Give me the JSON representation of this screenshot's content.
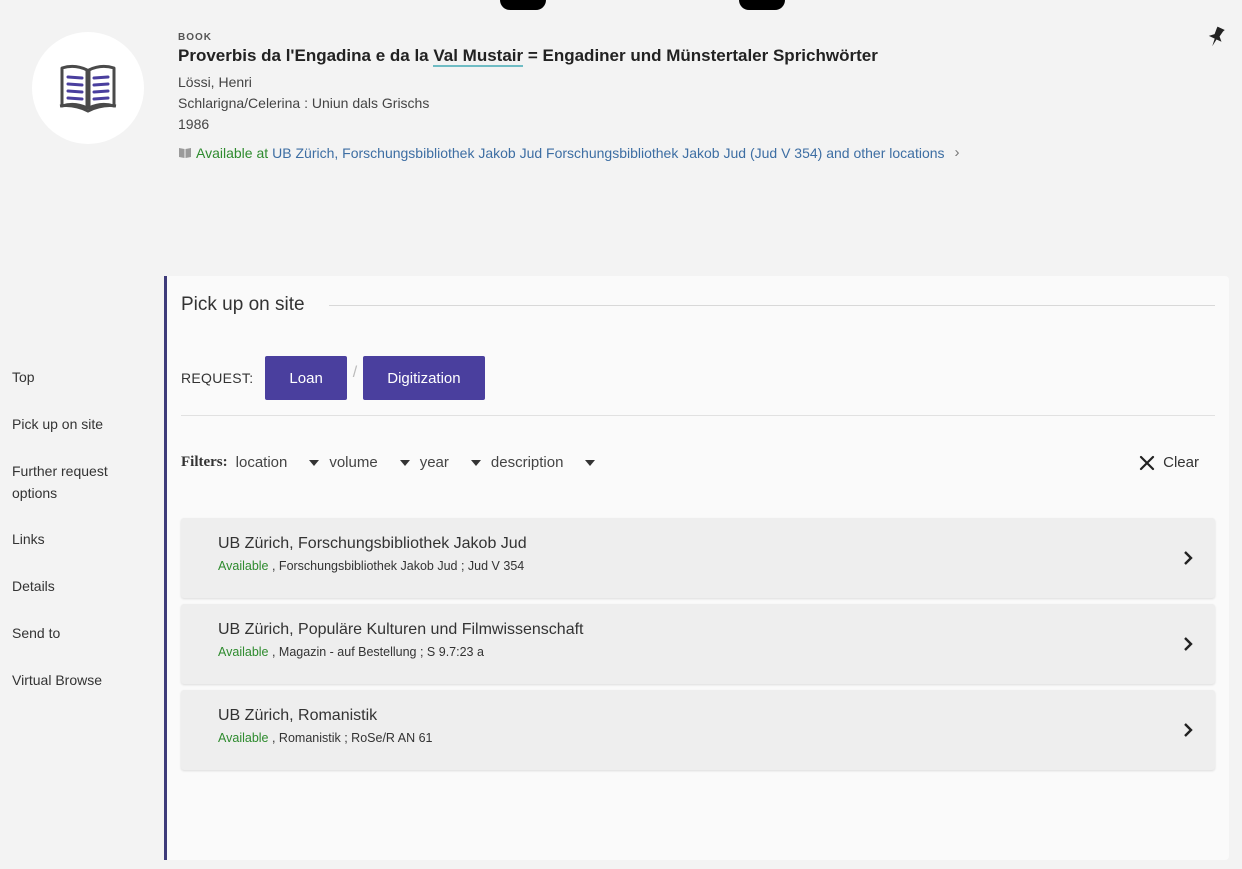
{
  "record": {
    "type": "BOOK",
    "title_before": "Proverbis da l'Engadina e da la ",
    "title_highlight": "Val Mustair",
    "title_after": " = Engadiner und Münstertaler Sprichwörter",
    "author": "Lössi, Henri",
    "publisher": "Schlarigna/Celerina : Uniun dals Grischs",
    "year": "1986",
    "availability_status": "Available at",
    "availability_location": "UB Zürich, Forschungsbibliothek Jakob Jud  Forschungsbibliothek Jakob Jud (Jud V 354) and other locations",
    "availability_chevron": "›"
  },
  "nav": {
    "items": [
      {
        "label": "Top"
      },
      {
        "label": "Pick up on site"
      },
      {
        "label": "Further request options"
      },
      {
        "label": "Links"
      },
      {
        "label": "Details"
      },
      {
        "label": "Send to"
      },
      {
        "label": "Virtual Browse"
      }
    ]
  },
  "section": {
    "heading": "Pick up on site",
    "request_label": "REQUEST:",
    "loan_label": "Loan",
    "separator": "/",
    "digitization_label": "Digitization",
    "filters_label": "Filters:",
    "filters": [
      "location",
      "volume",
      "year",
      "description"
    ],
    "clear_label": "Clear"
  },
  "holdings": [
    {
      "library": "UB Zürich, Forschungsbibliothek Jakob Jud",
      "status": "Available",
      "detail": " , Forschungsbibliothek Jakob Jud ; Jud V 354"
    },
    {
      "library": "UB Zürich, Populäre Kulturen und Filmwissenschaft",
      "status": "Available",
      "detail": " , Magazin - auf Bestellung ; S 9.7:23 a"
    },
    {
      "library": "UB Zürich, Romanistik",
      "status": "Available",
      "detail": " , Romanistik ; RoSe/R AN 61"
    }
  ],
  "colors": {
    "accent": "#4a3f9e",
    "panel_border": "#3e3b7a",
    "available": "#2e8b2e",
    "link": "#3d6ea3"
  }
}
